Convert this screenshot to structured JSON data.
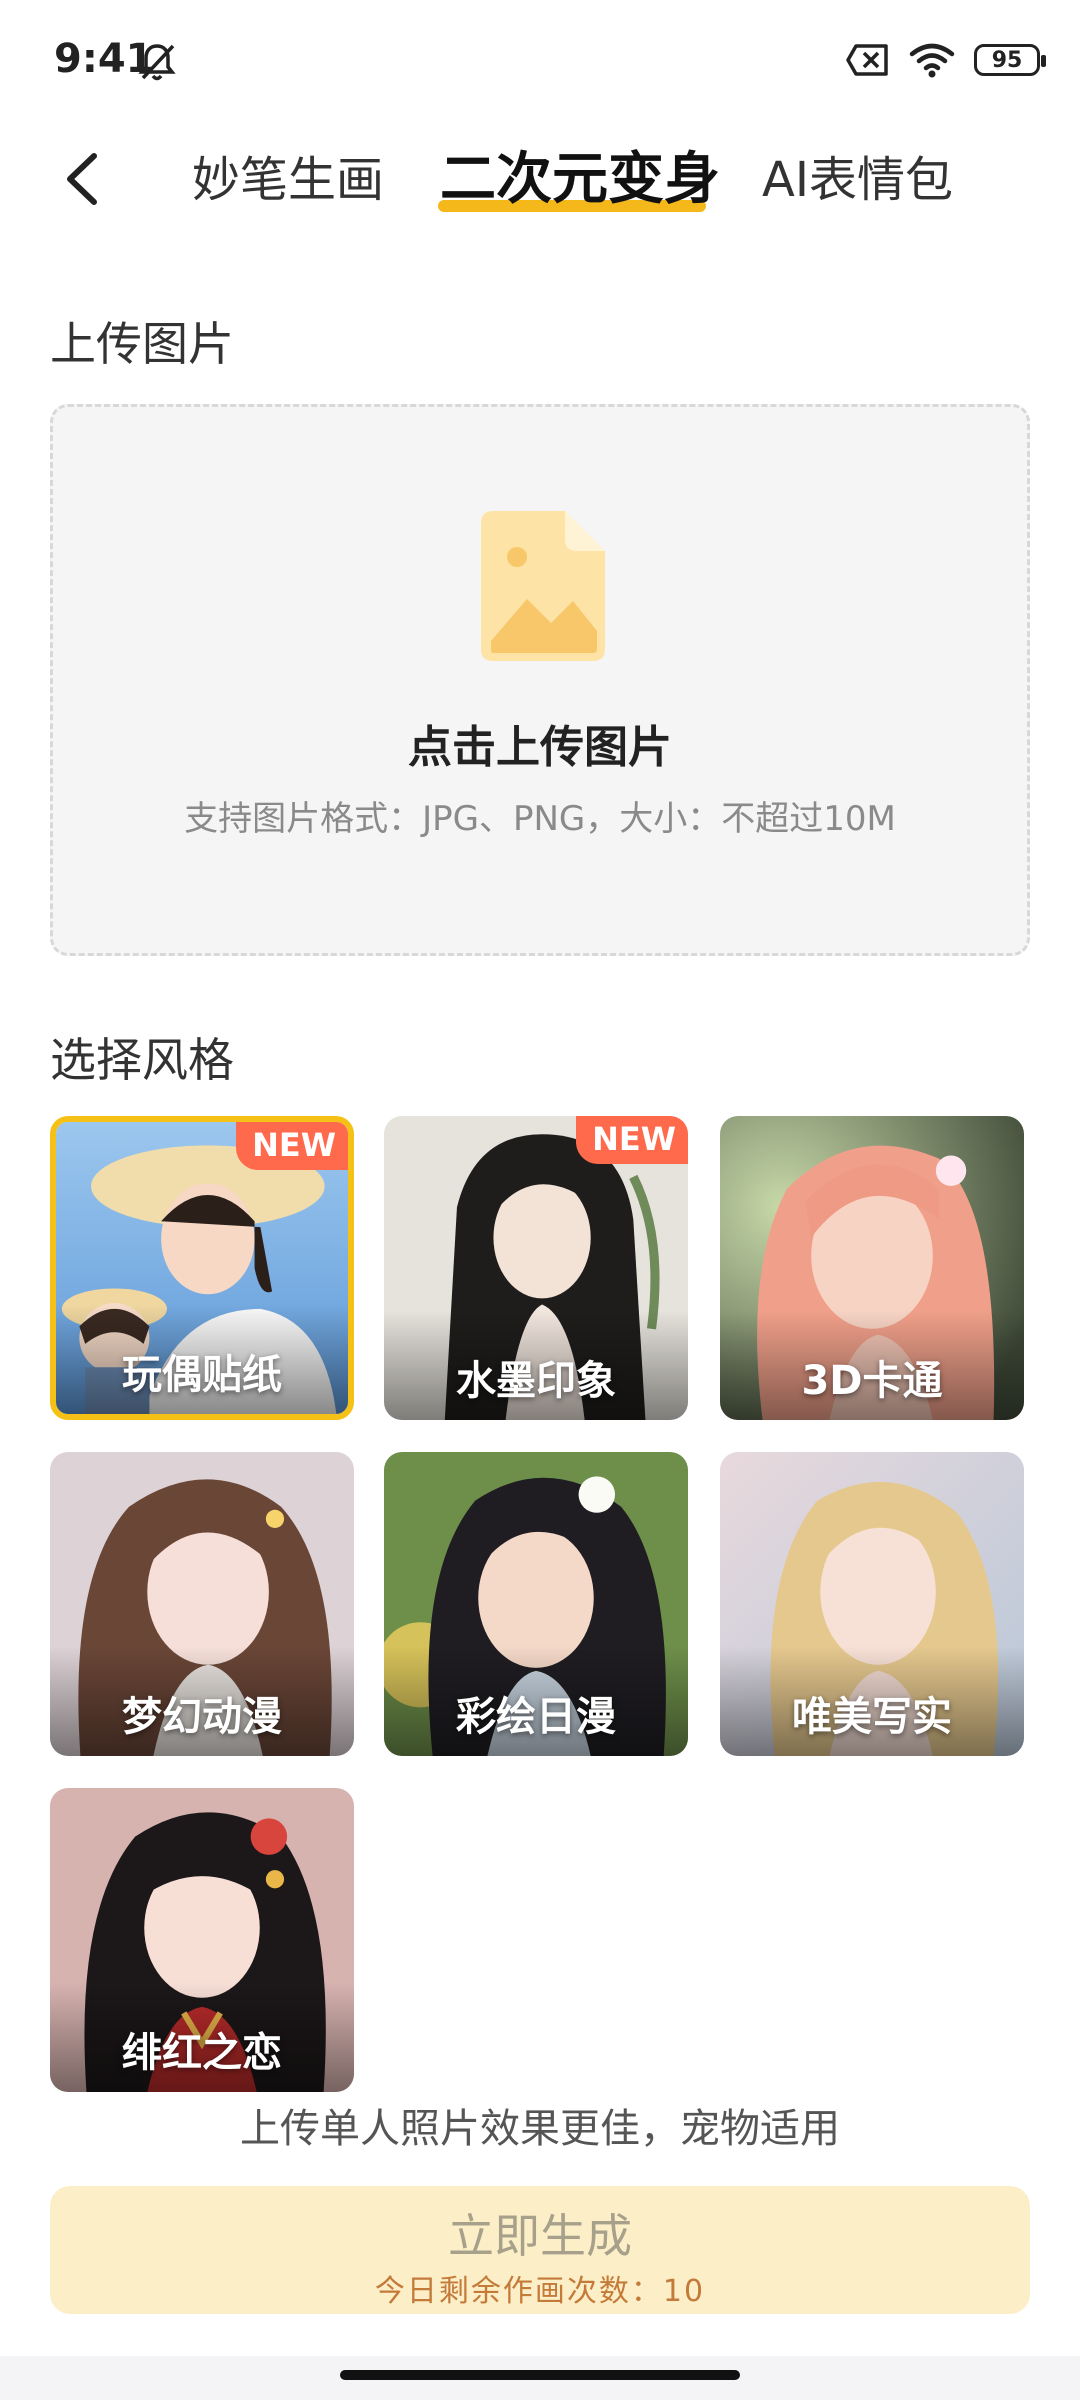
{
  "status": {
    "time": "9:41",
    "battery": "95"
  },
  "tabs": [
    {
      "label": "妙笔生画",
      "active": false
    },
    {
      "label": "二次元变身",
      "active": true
    },
    {
      "label": "AI表情包",
      "active": false
    }
  ],
  "upload": {
    "section_title": "上传图片",
    "main_text": "点击上传图片",
    "sub_text": "支持图片格式：JPG、PNG，大小：不超过10M"
  },
  "styles": {
    "section_title": "选择风格",
    "items": [
      {
        "label": "玩偶贴纸",
        "badge": "NEW",
        "selected": true
      },
      {
        "label": "水墨印象",
        "badge": "NEW",
        "selected": false
      },
      {
        "label": "3D卡通",
        "badge": "",
        "selected": false
      },
      {
        "label": "梦幻动漫",
        "badge": "",
        "selected": false
      },
      {
        "label": "彩绘日漫",
        "badge": "",
        "selected": false
      },
      {
        "label": "唯美写实",
        "badge": "",
        "selected": false
      },
      {
        "label": "绯红之恋",
        "badge": "",
        "selected": false
      }
    ]
  },
  "hint": "上传单人照片效果更佳，宠物适用",
  "generate": {
    "label": "立即生成",
    "count_text": "今日剩余作画次数：10"
  },
  "colors": {
    "accent": "#f5b81a",
    "badge": "#ff6a4d",
    "button_bg": "#fcefc8"
  },
  "icons": [
    "bell-off-icon",
    "close-box-icon",
    "wifi-icon",
    "battery-icon",
    "back-arrow-icon",
    "image-file-icon"
  ]
}
